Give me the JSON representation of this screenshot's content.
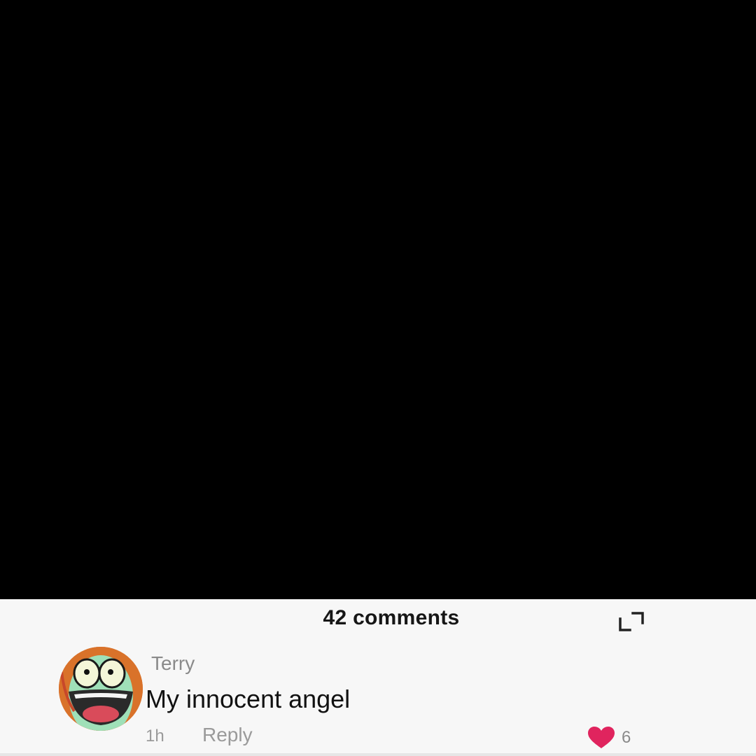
{
  "header": {
    "comment_count": "42 comments"
  },
  "comment": {
    "username": "Terry",
    "text": "My innocent angel",
    "timestamp": "1h",
    "reply_label": "Reply",
    "like_count": "6",
    "avatar_icon": "cartoon-avatar"
  },
  "icons": {
    "expand": "expand-icon",
    "heart": "heart-icon"
  },
  "colors": {
    "video_background": "#000000",
    "sheet_background": "#f7f7f7",
    "heart": "#e0245e"
  }
}
